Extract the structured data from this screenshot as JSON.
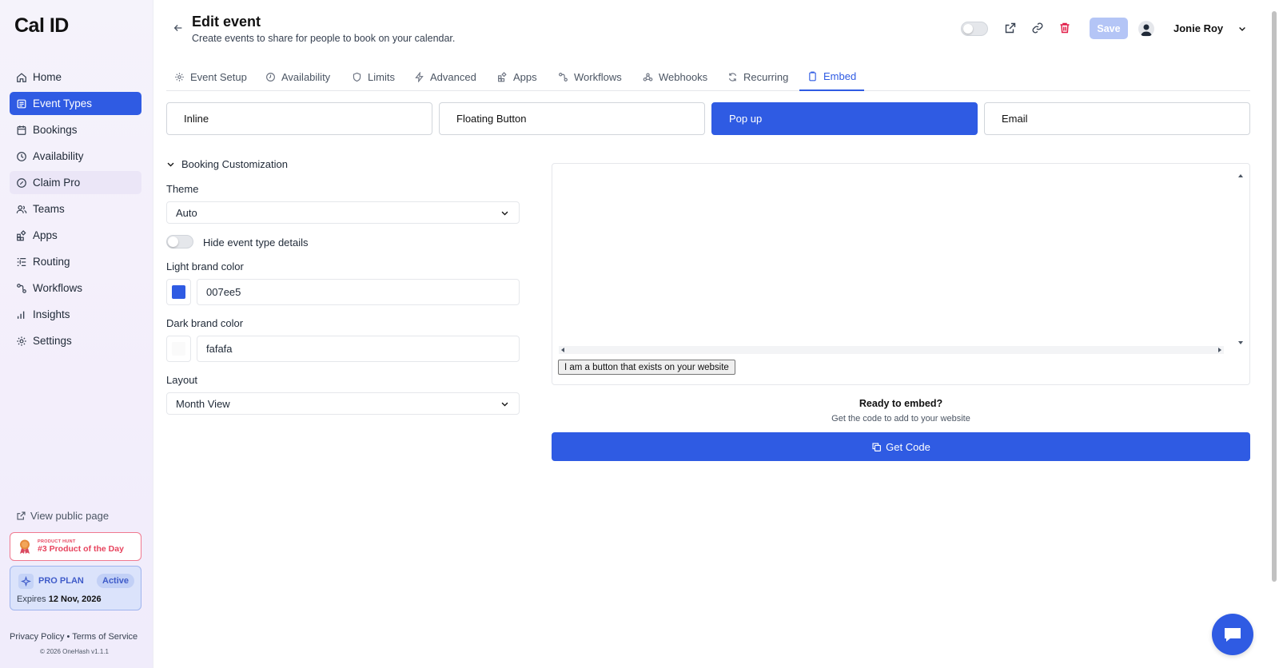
{
  "app": {
    "logo": "Cal ID"
  },
  "sidebar": {
    "items": [
      {
        "label": "Home",
        "icon": "home-icon"
      },
      {
        "label": "Event Types",
        "icon": "event-types-icon"
      },
      {
        "label": "Bookings",
        "icon": "calendar-icon"
      },
      {
        "label": "Availability",
        "icon": "clock-icon"
      },
      {
        "label": "Claim Pro",
        "icon": "badge-icon"
      },
      {
        "label": "Teams",
        "icon": "users-icon"
      },
      {
        "label": "Apps",
        "icon": "grid-icon"
      },
      {
        "label": "Routing",
        "icon": "routing-icon"
      },
      {
        "label": "Workflows",
        "icon": "workflow-icon"
      },
      {
        "label": "Insights",
        "icon": "chart-icon"
      },
      {
        "label": "Settings",
        "icon": "gear-icon"
      }
    ],
    "active_index": 1,
    "public_page": "View public page",
    "product_hunt": {
      "small": "PRODUCT HUNT",
      "big": "#3 Product of the Day"
    },
    "plan": {
      "name": "PRO PLAN",
      "status": "Active",
      "expires_label": "Expires",
      "expires_date": "12 Nov, 2026"
    },
    "legal": "Privacy Policy • Terms of Service",
    "copyright": "© 2026 OneHash v1.1.1"
  },
  "header": {
    "title": "Edit event",
    "subtitle": "Create events to share for people to book on your calendar.",
    "save_label": "Save",
    "user_name": "Jonie Roy"
  },
  "tabs": [
    {
      "label": "Event Setup",
      "icon": "gear-icon"
    },
    {
      "label": "Availability",
      "icon": "clock-icon"
    },
    {
      "label": "Limits",
      "icon": "shield-icon"
    },
    {
      "label": "Advanced",
      "icon": "bolt-icon"
    },
    {
      "label": "Apps",
      "icon": "grid-icon"
    },
    {
      "label": "Workflows",
      "icon": "workflow-icon"
    },
    {
      "label": "Webhooks",
      "icon": "webhook-icon"
    },
    {
      "label": "Recurring",
      "icon": "refresh-icon"
    },
    {
      "label": "Embed",
      "icon": "clipboard-icon"
    }
  ],
  "active_tab": "Embed",
  "embed_types": [
    "Inline",
    "Floating Button",
    "Pop up",
    "Email"
  ],
  "active_embed": "Pop up",
  "customization": {
    "heading": "Booking Customization",
    "theme_label": "Theme",
    "theme_value": "Auto",
    "hide_details_label": "Hide event type details",
    "hide_details_on": false,
    "light_label": "Light brand color",
    "light_value": "007ee5",
    "light_swatch": "#2f5be3",
    "dark_label": "Dark brand color",
    "dark_value": "fafafa",
    "dark_swatch": "#fafafa",
    "layout_label": "Layout",
    "layout_value": "Month View"
  },
  "preview": {
    "button_text": "I am a button that exists on your website",
    "ready_title": "Ready to embed?",
    "ready_sub": "Get the code to add to your website",
    "get_code": "Get Code"
  },
  "colors": {
    "accent": "#2f5be3",
    "danger": "#e11d48",
    "save_disabled": "#b4c5f6"
  }
}
